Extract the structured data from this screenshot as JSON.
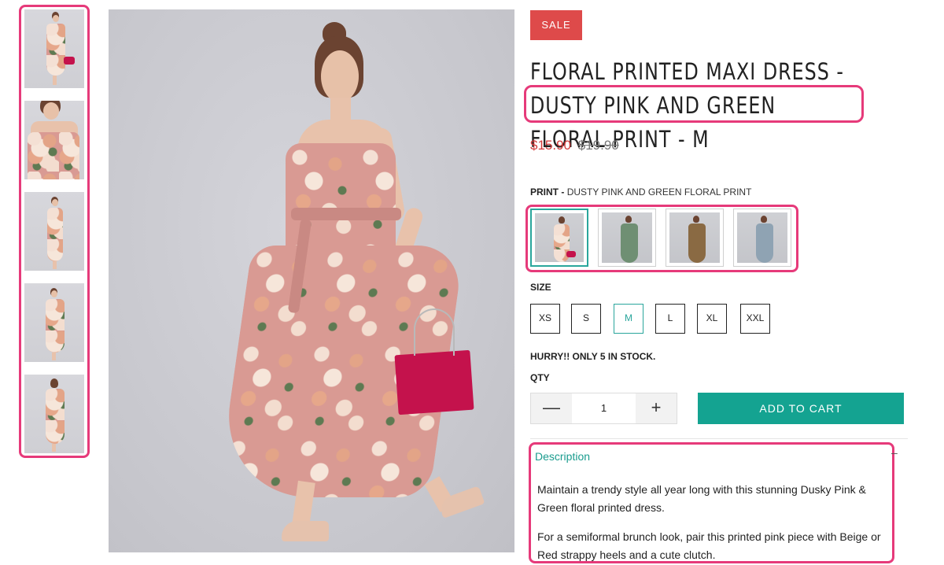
{
  "product": {
    "badge": "SALE",
    "title": "FLORAL PRINTED MAXI DRESS - DUSTY PINK AND GREEN FLORAL PRINT - M",
    "price_current": "$15.90",
    "price_original": "$19.90",
    "print_label": "PRINT -",
    "print_value": "DUSTY PINK AND GREEN FLORAL PRINT",
    "size_label": "SIZE",
    "sizes": [
      "XS",
      "S",
      "M",
      "L",
      "XL",
      "XXL"
    ],
    "selected_size": "M",
    "stock_notice": "HURRY!! ONLY 5 IN STOCK.",
    "qty_label": "QTY",
    "qty_value": "1",
    "qty_minus_icon": "minus-icon",
    "qty_plus_icon": "plus-icon",
    "add_to_cart": "ADD TO CART"
  },
  "description": {
    "title": "Description",
    "collapse_icon": "minus-icon",
    "paragraphs": [
      "Maintain a trendy style all year long with this stunning Dusky Pink & Green floral printed dress.",
      "For a semiformal brunch look, pair this printed pink piece with Beige or Red strappy heels and a cute clutch."
    ]
  },
  "colors": {
    "accent": "#14a391",
    "sale": "#de4a4a",
    "price": "#d23b3b",
    "highlight": "#e63a7a",
    "dress_pink": "#d99a93"
  }
}
